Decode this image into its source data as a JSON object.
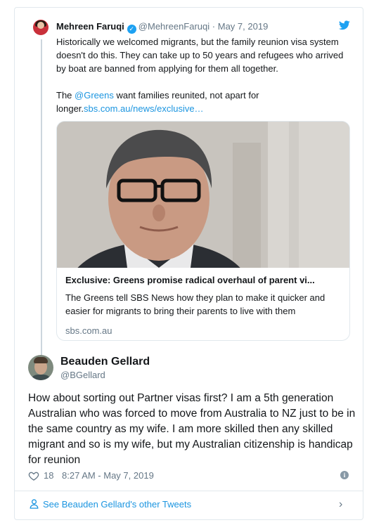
{
  "tweet1": {
    "name": "Mehreen Faruqi",
    "handle": "@MehreenFaruqi",
    "separator": "·",
    "date": "May 7, 2019",
    "para1": "Historically we welcomed migrants, but the family reunion visa system doesn't do this. They can take up to 50 years and refugees who arrived by boat are banned from applying for them all together.",
    "para2_pre": "The ",
    "mention": "@Greens",
    "para2_mid": " want families reunited, not apart for longer.",
    "link": "sbs.com.au/news/exclusive…",
    "card": {
      "title": "Exclusive: Greens promise radical overhaul of parent vi...",
      "description": "The Greens tell SBS News how they plan to make it quicker and easier for migrants to bring their parents to live with them",
      "domain": "sbs.com.au"
    }
  },
  "tweet2": {
    "name": "Beauden Gellard",
    "handle": "@BGellard",
    "text": "How about sorting out Partner visas first? I am a 5th generation Australian who was forced to move from Australia to NZ just to be in the same country as my wife. I am more skilled then any skilled migrant and so is my wife, but my Australian citizenship is handicap for reunion",
    "likes": "18",
    "timestamp": "8:27 AM - May 7, 2019"
  },
  "footer": {
    "label": "See Beauden Gellard's other Tweets"
  },
  "icons": {
    "verified": "verified-badge-icon",
    "bird": "twitter-bird-icon",
    "heart": "heart-icon",
    "info": "info-icon",
    "person": "person-icon",
    "chevron": "chevron-right-icon"
  },
  "colors": {
    "link": "#1b95e0",
    "verified": "#1da1f2",
    "muted": "#657786",
    "border": "#e1e8ed"
  }
}
